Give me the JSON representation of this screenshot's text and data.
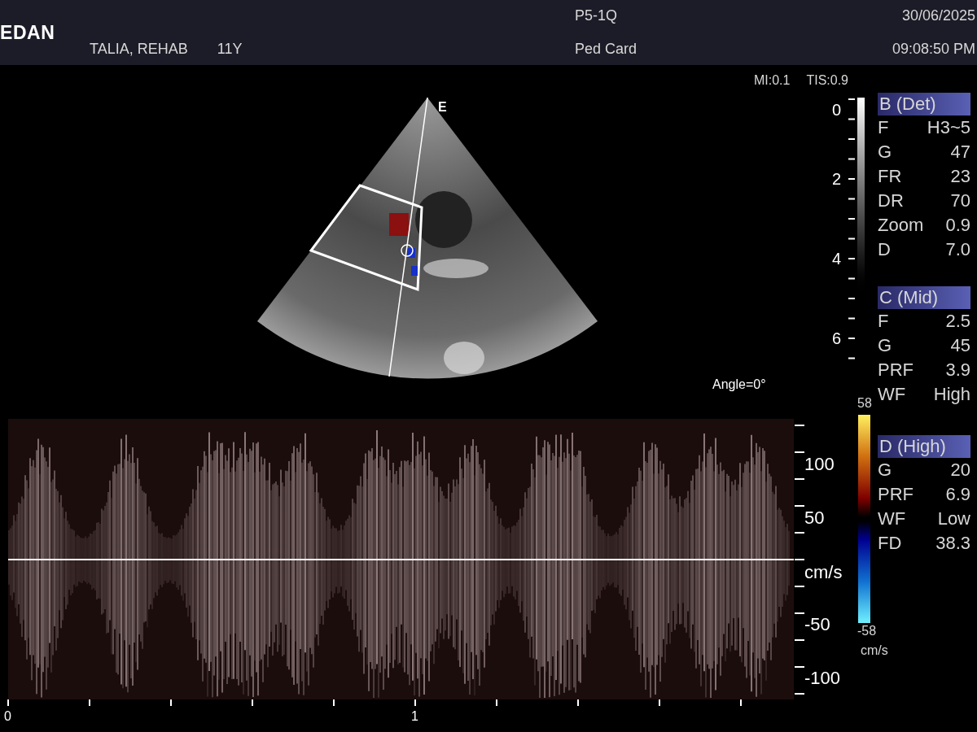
{
  "header": {
    "logo": "EDAN",
    "patient_name": "TALIA, REHAB",
    "patient_age": "11Y",
    "probe": "P5-1Q",
    "preset": "Ped Card",
    "date": "30/06/2025",
    "time": "09:08:50 PM"
  },
  "indices": [
    "MI:0.1",
    "TIS:0.9"
  ],
  "image": {
    "orientation_mark": "E",
    "angle": "Angle=0°",
    "depth_ticks": [
      "0",
      "2",
      "4",
      "6"
    ]
  },
  "parameter_groups": [
    {
      "title": "B (Det)",
      "params": [
        {
          "label": "F",
          "value": "H3~5"
        },
        {
          "label": "G",
          "value": "47"
        },
        {
          "label": "FR",
          "value": "23"
        },
        {
          "label": "DR",
          "value": "70"
        },
        {
          "label": "Zoom",
          "value": "0.9"
        },
        {
          "label": "D",
          "value": "7.0"
        }
      ]
    },
    {
      "title": "C (Mid)",
      "params": [
        {
          "label": "F",
          "value": "2.5"
        },
        {
          "label": "G",
          "value": "45"
        },
        {
          "label": "PRF",
          "value": "3.9"
        },
        {
          "label": "WF",
          "value": "High"
        }
      ]
    },
    {
      "title": "D (High)",
      "params": [
        {
          "label": "G",
          "value": "20"
        },
        {
          "label": "PRF",
          "value": "6.9"
        },
        {
          "label": "WF",
          "value": "Low"
        },
        {
          "label": "FD",
          "value": "38.3"
        }
      ]
    }
  ],
  "color_scale": {
    "max": "58",
    "min": "-58",
    "unit": "cm/s"
  },
  "spectrum": {
    "velocity_ticks": [
      "100",
      "50",
      "cm/s",
      "-50",
      "-100"
    ],
    "time_ticks": [
      "0",
      "1"
    ]
  }
}
